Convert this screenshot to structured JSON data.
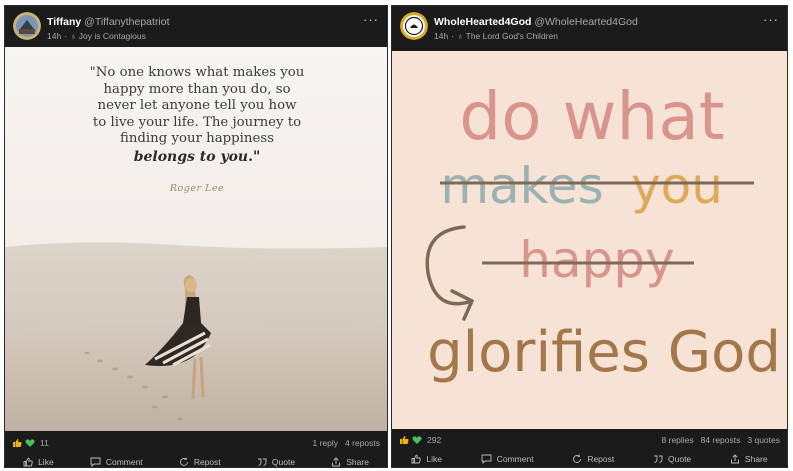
{
  "posts": [
    {
      "author_name": "Tiffany",
      "author_handle": "@Tiffanythepatriot",
      "time": "14h",
      "group": "Joy is Contagious",
      "quote": {
        "lines": [
          "\"No one knows what makes you",
          "happy more than you do, so",
          "never let anyone tell you how",
          "to live your life. The journey to",
          "finding your happiness"
        ],
        "emphasis": "belongs to you.\"",
        "signature": "Roger Lee"
      },
      "reaction_count": "11",
      "replies": "1 reply",
      "reposts": "4 reposts",
      "quotes": "",
      "actions": {
        "like": "Like",
        "comment": "Comment",
        "repost": "Repost",
        "quote": "Quote",
        "share": "Share"
      },
      "colors": {
        "like": "#f2b400",
        "love": "#46c35a"
      }
    },
    {
      "author_name": "WholeHearted4God",
      "author_handle": "@WholeHearted4God",
      "time": "14h",
      "group": "The Lord God's Children",
      "art": {
        "line1": "do what",
        "line2a": "makes",
        "line2b": "you",
        "line3": "happy",
        "line4": "glorifies God"
      },
      "reaction_count": "292",
      "replies": "8 replies",
      "reposts": "84 reposts",
      "quotes": "3 quotes",
      "actions": {
        "like": "Like",
        "comment": "Comment",
        "repost": "Repost",
        "quote": "Quote",
        "share": "Share"
      },
      "colors": {
        "like": "#f2b400",
        "love": "#46c35a"
      }
    }
  ]
}
